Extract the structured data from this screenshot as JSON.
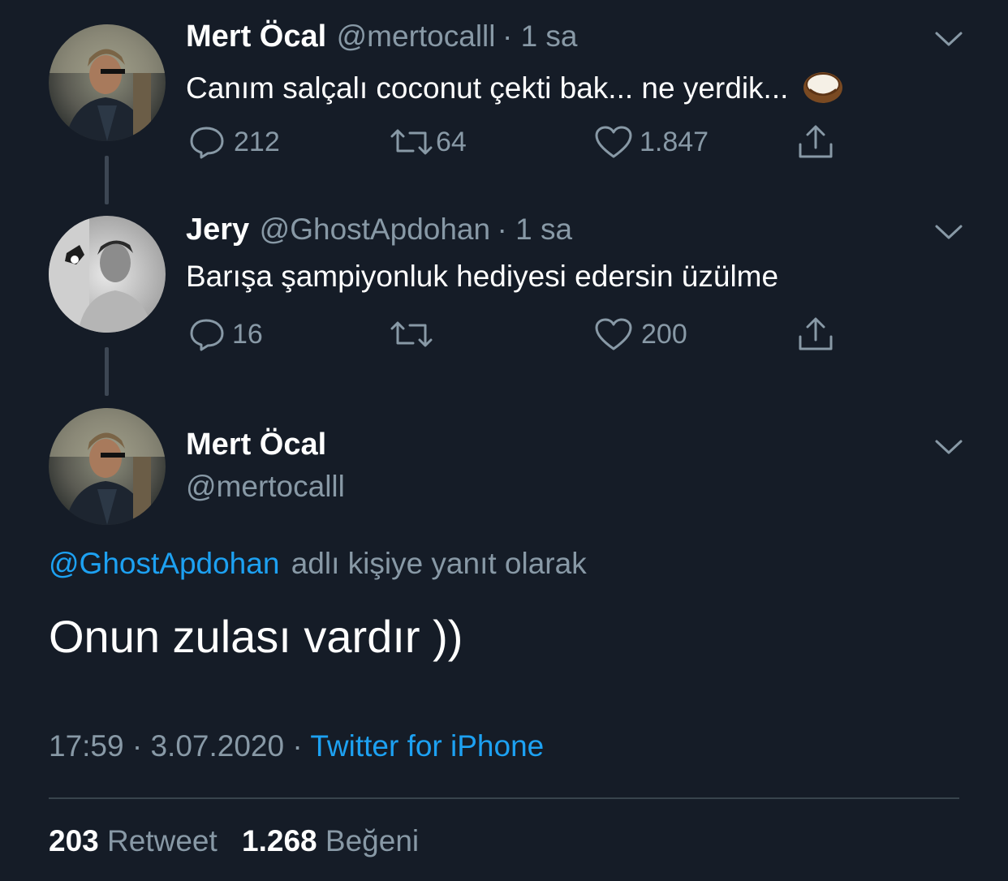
{
  "colors": {
    "background": "#151c27",
    "muted": "#8899a6",
    "accent": "#1da1f2",
    "divider": "#38444d"
  },
  "tweets": [
    {
      "name": "Mert Öcal",
      "handle": "@mertocalll",
      "time": "· 1 sa",
      "text": "Canım salçalı coconut çekti bak... ne yerdik...",
      "emoji": "coconut-emoji",
      "replies": "212",
      "retweets": "64",
      "likes": "1.847"
    },
    {
      "name": "Jery",
      "handle": "@GhostApdohan",
      "time": "· 1 sa",
      "text": "Barışa şampiyonluk hediyesi edersin üzülme",
      "replies": "16",
      "retweets": "",
      "likes": "200"
    }
  ],
  "main": {
    "name": "Mert Öcal",
    "handle": "@mertocalll",
    "reply_to_handle": "@GhostApdohan",
    "reply_to_suffix": "adlı kişiye yanıt olarak",
    "text": "Onun zulası vardır ))",
    "time": "17:59",
    "date": "3.07.2020",
    "separator": "·",
    "source": "Twitter for iPhone",
    "retweet_count": "203",
    "retweet_label": "Retweet",
    "like_count": "1.268",
    "like_label": "Beğeni"
  },
  "icons": [
    "reply-icon",
    "retweet-icon",
    "like-icon",
    "share-icon",
    "chevron-down-icon"
  ]
}
